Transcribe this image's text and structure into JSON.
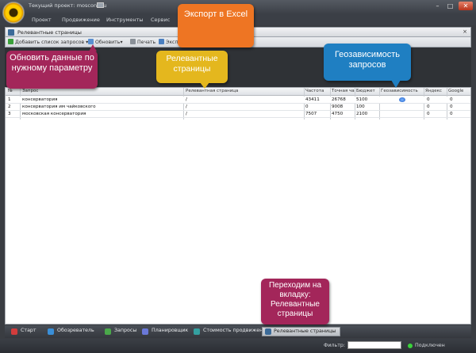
{
  "window": {
    "title": "Текущий проект: moscons.ru"
  },
  "menu": [
    {
      "label": "Проект"
    },
    {
      "label": "Продвижение"
    },
    {
      "label": "Инструменты"
    },
    {
      "label": "Сервис"
    }
  ],
  "panel": {
    "title": "Релевантные страницы",
    "close": "×"
  },
  "toolbar": {
    "add_label": "Добавить список запросов",
    "refresh_label": "Обновить",
    "print_label": "Печать",
    "export_label": "Экспорт"
  },
  "grid": {
    "columns": [
      "№",
      "Запрос",
      "Релевантная страница",
      "Частота",
      "Точная частота",
      "Бюджет",
      "Геозависимость",
      "Яндекс",
      "Google"
    ],
    "columns_visible": [
      "№",
      "Запрос",
      "Релевантная страница",
      "Частота",
      "Точная час",
      "Бюджет",
      "Геозависимость",
      "Яндекс",
      "Google"
    ],
    "rows": [
      {
        "n": "1",
        "query": "консерватория",
        "page": "/",
        "freq": "43411",
        "exact": "26768",
        "budget": "5100",
        "geo": true,
        "yandex": "0",
        "google": "0"
      },
      {
        "n": "2",
        "query": "консерватория им чайковского",
        "page": "/",
        "freq": "0",
        "exact": "9008",
        "budget": "100",
        "geo": false,
        "yandex": "0",
        "google": "0"
      },
      {
        "n": "3",
        "query": "московская консерватория",
        "page": "/",
        "freq": "7507",
        "exact": "4750",
        "budget": "2100",
        "geo": false,
        "yandex": "0",
        "google": "0"
      }
    ]
  },
  "tabs": [
    {
      "label": "Старт",
      "icon": "start-icon",
      "color": "#d23c3c"
    },
    {
      "label": "Обозреватель",
      "icon": "browser-icon",
      "color": "#3a8fd8"
    },
    {
      "label": "Запросы",
      "icon": "queries-icon",
      "color": "#4aa84a"
    },
    {
      "label": "Планировщик",
      "icon": "scheduler-icon",
      "color": "#6a78d8"
    },
    {
      "label": "Стоимость продвижения",
      "icon": "cost-icon",
      "color": "#34a0a0"
    },
    {
      "label": "Релевантные страницы",
      "icon": "relevant-pages-icon",
      "color": "#3b6a98",
      "active": true
    }
  ],
  "status": {
    "filter_label": "Фильтр:",
    "filter_value": "",
    "connection": "Подключен"
  },
  "callouts": {
    "export": "Экспорт в Excel",
    "update": "Обновить данные по нужному параметру",
    "relevant": "Релевантные страницы",
    "geo": "Геозависимость запросов",
    "tab": "Переходим на вкладку: Релевантные страницы"
  },
  "colors": {
    "callout_orange": "#ee7523",
    "callout_magenta": "#a3265a",
    "callout_yellow": "#e4b71e",
    "callout_blue": "#1f7fc2",
    "status_online": "#3ad23a"
  }
}
